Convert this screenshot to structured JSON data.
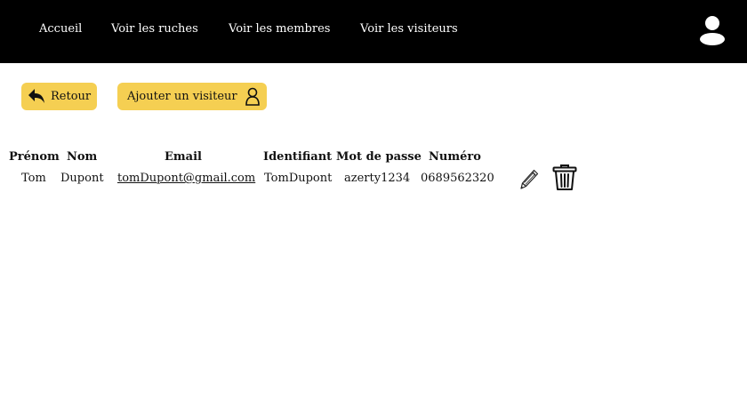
{
  "nav": {
    "items": [
      {
        "label": "Accueil"
      },
      {
        "label": "Voir les ruches"
      },
      {
        "label": "Voir les membres"
      },
      {
        "label": "Voir les visiteurs"
      }
    ],
    "profile_icon": "user-icon"
  },
  "actions": {
    "back_label": "Retour",
    "back_icon": "reply-arrow-icon",
    "add_label": "Ajouter un visiteur",
    "add_icon": "user-outline-icon"
  },
  "table": {
    "headers": [
      "Prénom",
      "Nom",
      "Email",
      "Identifiant",
      "Mot de passe",
      "Numéro"
    ],
    "rows": [
      {
        "cells": [
          "Tom",
          "Dupont",
          "tomDupont@gmail.com",
          "TomDupont",
          "azerty1234",
          "0689562320"
        ],
        "edit_icon": "pencil-icon",
        "delete_icon": "trash-icon"
      }
    ]
  },
  "colors": {
    "topbar": "#000000",
    "button": "#f5cf52"
  }
}
